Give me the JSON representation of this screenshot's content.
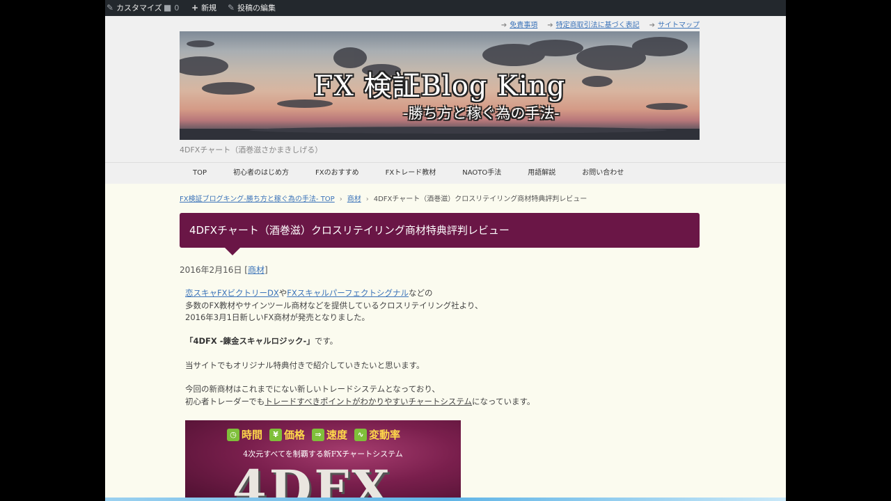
{
  "admin_bar": {
    "customize": "カスタマイズ",
    "comments_count": "0",
    "new": "新規",
    "edit_post": "投稿の編集"
  },
  "header": {
    "top_links": [
      "免責事項",
      "特定商取引法に基づく表記",
      "サイトマップ"
    ],
    "banner_title": "FX 検証Blog King",
    "banner_subtitle": "-勝ち方と稼ぐ為の手法-",
    "tagline": "4DFXチャート（酒巻滋さかまきしげる）"
  },
  "nav": {
    "items": [
      "TOP",
      "初心者のはじめ方",
      "FXのおすすめ",
      "FXトレード教材",
      "NAOTO手法",
      "用語解説",
      "お問い合わせ"
    ]
  },
  "breadcrumb": {
    "home": "FX検証ブログキング-勝ち方と稼ぐ為の手法- TOP",
    "category": "商材",
    "current": "4DFXチャート（酒巻滋）クロスリテイリング商材特典評判レビュー"
  },
  "post": {
    "title": "4DFXチャート（酒巻滋）クロスリテイリング商材特典評判レビュー",
    "date": "2016年2月16日",
    "category": "商材",
    "para1": {
      "link1": "恋スキャFXビクトリーDX",
      "mid": "や",
      "link2": "FXスキャルパーフェクトシグナル",
      "end": "などの",
      "line2": "多数のFX教材やサインツール商材などを提供しているクロスリテイリング社より、",
      "line3": "2016年3月1日新しいFX商材が発売となりました。"
    },
    "product_name": "「4DFX -錬金スキャルロジック-」",
    "product_suffix": "です。",
    "para3": "当サイトでもオリジナル特典付きで紹介していきたいと思います。",
    "para4_line1": "今回の新商材はこれまでにない新しいトレードシステムとなっており、",
    "para4_line2_pre": "初心者トレーダーでも",
    "para4_line2_ul": "トレードすべきポイントがわかりやすいチャートシステム",
    "para4_line2_post": "になっています。"
  },
  "product_image": {
    "features": [
      "時間",
      "価格",
      "速度",
      "変動率"
    ],
    "tagline": "4次元すべてを制覇する新FXチャートシステム",
    "logo": "4DFX"
  }
}
